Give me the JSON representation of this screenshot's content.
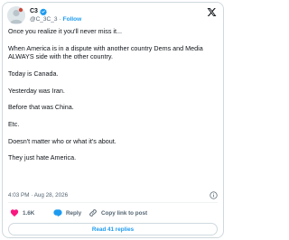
{
  "author": {
    "display_name": "C3",
    "handle": "@C_3C_3",
    "separator": "·",
    "follow_label": "Follow"
  },
  "tweet": {
    "paragraphs": [
      "Once you realize it you'll never miss it...",
      "When America is in a dispute with another country Dems and Media ALWAYS side with the other country.",
      "Today is Canada.",
      "Yesterday was Iran.",
      "Before that was China.",
      "Etc.",
      "Doesn't matter who or what it's about.",
      "They just hate America."
    ],
    "timestamp": "4:03 PM · Aug 28, 2026"
  },
  "actions": {
    "like_count": "1.6K",
    "reply_label": "Reply",
    "copy_link_label": "Copy link to post",
    "read_replies_label": "Read 41 replies"
  },
  "colors": {
    "accent": "#1d9bf0",
    "like": "#f91880",
    "text": "#0f1419",
    "secondary": "#536471"
  },
  "icons": [
    "verified-badge-icon",
    "x-logo-icon",
    "info-icon",
    "heart-icon",
    "reply-icon",
    "link-icon"
  ]
}
